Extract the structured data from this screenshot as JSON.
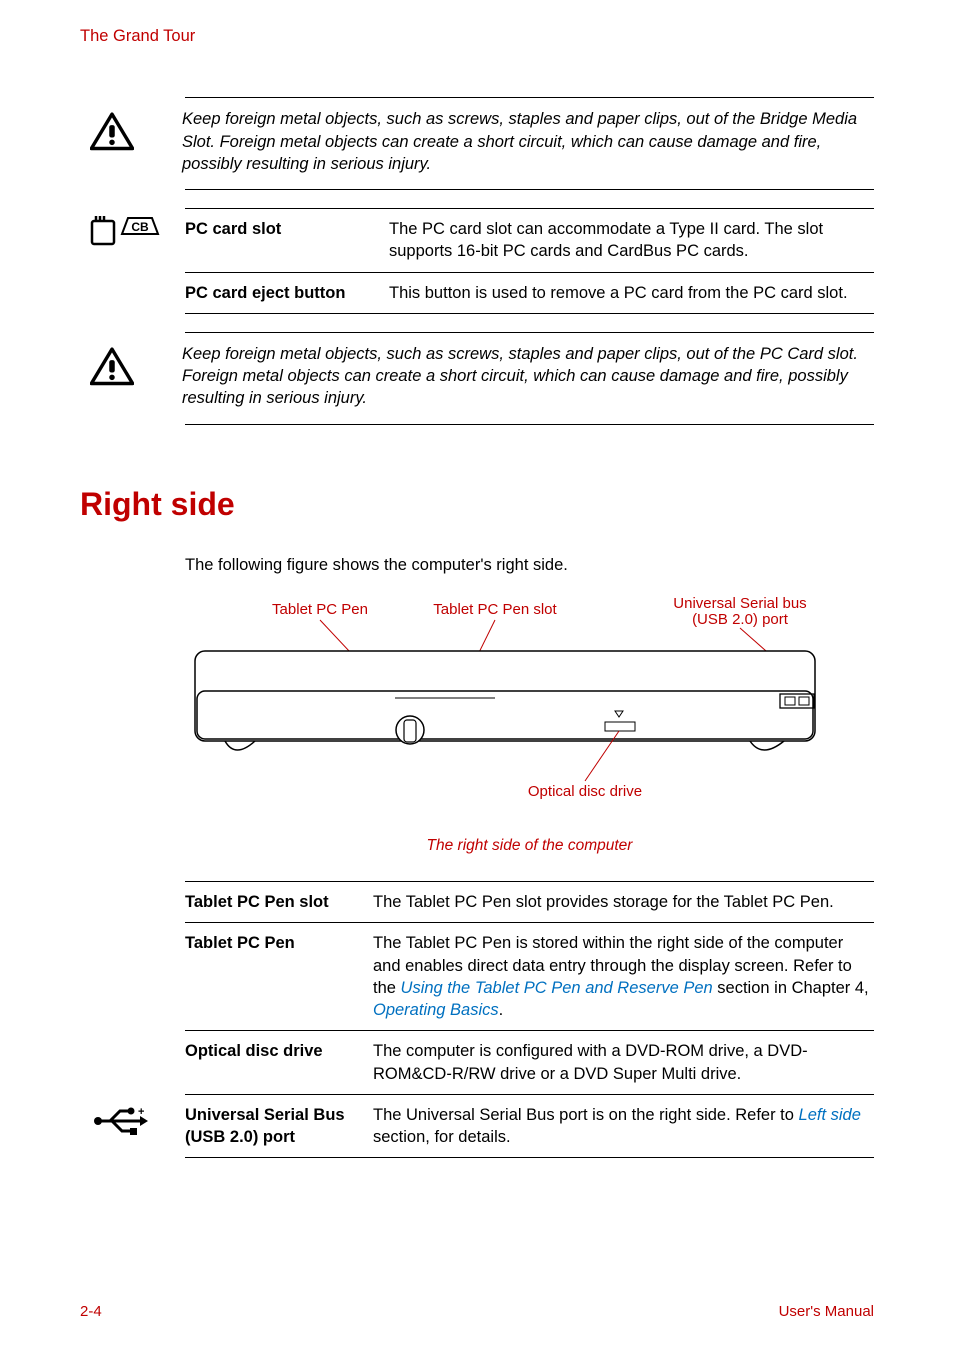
{
  "header": {
    "title": "The Grand Tour"
  },
  "warning1": "Keep foreign metal objects, such as screws, staples and paper clips, out of the Bridge Media Slot. Foreign metal objects can create a short circuit, which can cause damage and fire, possibly resulting in serious injury.",
  "table1": {
    "row1": {
      "label": "PC card slot",
      "desc": "The PC card slot can accommodate a Type II card. The slot supports 16-bit PC cards and CardBus PC cards."
    },
    "row2": {
      "label": "PC card eject button",
      "desc": "This button is used to remove a PC card from the PC card slot."
    }
  },
  "warning2": "Keep foreign metal objects, such as screws, staples and paper clips, out of the PC Card slot. Foreign metal objects can create a short circuit, which can cause damage and fire, possibly resulting in serious injury.",
  "section": {
    "heading": "Right side",
    "intro": "The following figure shows the computer's right side."
  },
  "figure": {
    "labels": {
      "pen": "Tablet PC Pen",
      "pen_slot": "Tablet PC Pen slot",
      "usb_l1": "Universal Serial bus",
      "usb_l2": "(USB 2.0) port",
      "odd": "Optical disc drive"
    },
    "caption": "The right side of the computer"
  },
  "table2": {
    "row1": {
      "label": "Tablet PC Pen slot",
      "desc": "The Tablet PC Pen slot provides storage for the Tablet PC Pen."
    },
    "row2": {
      "label": "Tablet PC Pen",
      "desc_a": "The Tablet PC Pen is stored within the right side of the computer and enables direct data entry through the display screen. Refer to the ",
      "link1": "Using the Tablet PC Pen and Reserve Pen",
      "desc_b": " section in Chapter 4, ",
      "link2": "Operating Basics",
      "desc_c": "."
    },
    "row3": {
      "label": "Optical disc drive",
      "desc": "The computer is configured with a DVD-ROM drive, a DVD-ROM&CD-R/RW drive or a DVD Super Multi drive."
    },
    "row4": {
      "label": "Universal Serial Bus (USB 2.0) port",
      "desc_a": "The Universal Serial Bus port is on the right side. Refer to ",
      "link": "Left side",
      "desc_b": " section, for details."
    }
  },
  "footer": {
    "page": "2-4",
    "manual": "User's Manual"
  }
}
